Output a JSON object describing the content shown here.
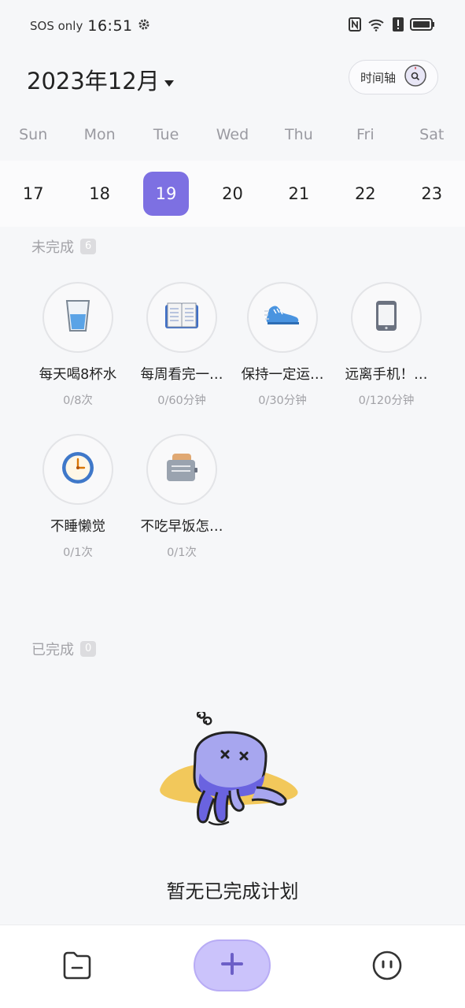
{
  "status_bar": {
    "carrier": "SOS only",
    "time": "16:51"
  },
  "header": {
    "month": "2023年12月",
    "timeline_label": "时间轴"
  },
  "week": {
    "days": [
      "Sun",
      "Mon",
      "Tue",
      "Wed",
      "Thu",
      "Fri",
      "Sat"
    ],
    "dates": [
      "17",
      "18",
      "19",
      "20",
      "21",
      "22",
      "23"
    ],
    "selected_date": "19"
  },
  "incomplete": {
    "title": "未完成",
    "count": "6",
    "items": [
      {
        "name": "每天喝8杯水",
        "progress": "0/8次",
        "icon": "water-glass-icon"
      },
      {
        "name": "每周看完一…",
        "progress": "0/60分钟",
        "icon": "book-icon"
      },
      {
        "name": "保持一定运…",
        "progress": "0/30分钟",
        "icon": "running-shoe-icon"
      },
      {
        "name": "远离手机！…",
        "progress": "0/120分钟",
        "icon": "phone-icon"
      },
      {
        "name": "不睡懒觉",
        "progress": "0/1次",
        "icon": "clock-icon"
      },
      {
        "name": "不吃早饭怎…",
        "progress": "0/1次",
        "icon": "toaster-icon"
      }
    ]
  },
  "completed": {
    "title": "已完成",
    "count": "0",
    "empty_text": "暂无已完成计划"
  },
  "colors": {
    "accent": "#7d70e2",
    "add_button": "#cbc3fb"
  }
}
